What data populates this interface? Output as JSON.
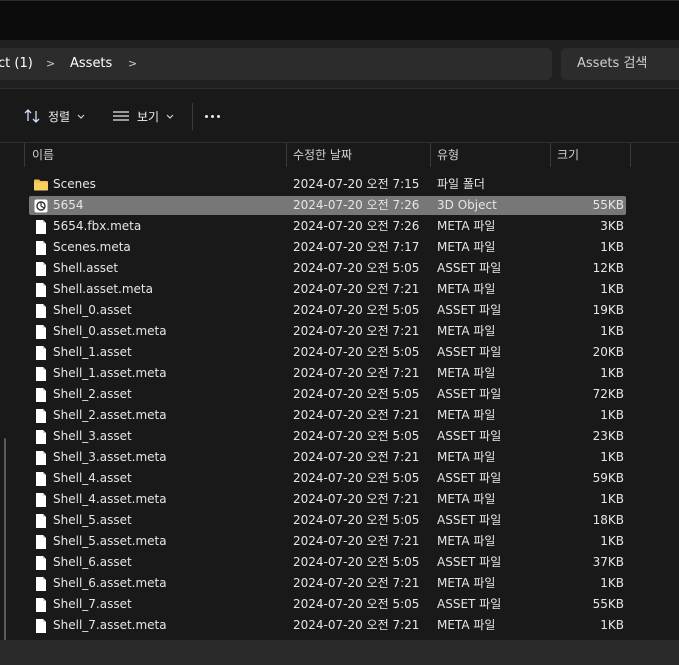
{
  "address": {
    "crumbs": [
      "ct (1)",
      "Assets"
    ],
    "search_placeholder": "Assets 검색"
  },
  "toolbar": {
    "sort_label": "정렬",
    "view_label": "보기"
  },
  "columns": {
    "name": "이름",
    "date": "수정한 날짜",
    "type": "유형",
    "size": "크기"
  },
  "files": [
    {
      "name": "Scenes",
      "date": "2024-07-20 오전 7:15",
      "type": "파일 폴더",
      "size": "",
      "icon": "folder-icon"
    },
    {
      "name": "5654",
      "date": "2024-07-20 오전 7:26",
      "type": "3D Object",
      "size": "55KB",
      "icon": "3d-object-icon",
      "selected": true
    },
    {
      "name": "5654.fbx.meta",
      "date": "2024-07-20 오전 7:26",
      "type": "META 파일",
      "size": "3KB",
      "icon": "file-icon"
    },
    {
      "name": "Scenes.meta",
      "date": "2024-07-20 오전 7:17",
      "type": "META 파일",
      "size": "1KB",
      "icon": "file-icon"
    },
    {
      "name": "Shell.asset",
      "date": "2024-07-20 오전 5:05",
      "type": "ASSET 파일",
      "size": "12KB",
      "icon": "file-icon"
    },
    {
      "name": "Shell.asset.meta",
      "date": "2024-07-20 오전 7:21",
      "type": "META 파일",
      "size": "1KB",
      "icon": "file-icon"
    },
    {
      "name": "Shell_0.asset",
      "date": "2024-07-20 오전 5:05",
      "type": "ASSET 파일",
      "size": "19KB",
      "icon": "file-icon"
    },
    {
      "name": "Shell_0.asset.meta",
      "date": "2024-07-20 오전 7:21",
      "type": "META 파일",
      "size": "1KB",
      "icon": "file-icon"
    },
    {
      "name": "Shell_1.asset",
      "date": "2024-07-20 오전 5:05",
      "type": "ASSET 파일",
      "size": "20KB",
      "icon": "file-icon"
    },
    {
      "name": "Shell_1.asset.meta",
      "date": "2024-07-20 오전 7:21",
      "type": "META 파일",
      "size": "1KB",
      "icon": "file-icon"
    },
    {
      "name": "Shell_2.asset",
      "date": "2024-07-20 오전 5:05",
      "type": "ASSET 파일",
      "size": "72KB",
      "icon": "file-icon"
    },
    {
      "name": "Shell_2.asset.meta",
      "date": "2024-07-20 오전 7:21",
      "type": "META 파일",
      "size": "1KB",
      "icon": "file-icon"
    },
    {
      "name": "Shell_3.asset",
      "date": "2024-07-20 오전 5:05",
      "type": "ASSET 파일",
      "size": "23KB",
      "icon": "file-icon"
    },
    {
      "name": "Shell_3.asset.meta",
      "date": "2024-07-20 오전 7:21",
      "type": "META 파일",
      "size": "1KB",
      "icon": "file-icon"
    },
    {
      "name": "Shell_4.asset",
      "date": "2024-07-20 오전 5:05",
      "type": "ASSET 파일",
      "size": "59KB",
      "icon": "file-icon"
    },
    {
      "name": "Shell_4.asset.meta",
      "date": "2024-07-20 오전 7:21",
      "type": "META 파일",
      "size": "1KB",
      "icon": "file-icon"
    },
    {
      "name": "Shell_5.asset",
      "date": "2024-07-20 오전 5:05",
      "type": "ASSET 파일",
      "size": "18KB",
      "icon": "file-icon"
    },
    {
      "name": "Shell_5.asset.meta",
      "date": "2024-07-20 오전 7:21",
      "type": "META 파일",
      "size": "1KB",
      "icon": "file-icon"
    },
    {
      "name": "Shell_6.asset",
      "date": "2024-07-20 오전 5:05",
      "type": "ASSET 파일",
      "size": "37KB",
      "icon": "file-icon"
    },
    {
      "name": "Shell_6.asset.meta",
      "date": "2024-07-20 오전 7:21",
      "type": "META 파일",
      "size": "1KB",
      "icon": "file-icon"
    },
    {
      "name": "Shell_7.asset",
      "date": "2024-07-20 오전 5:05",
      "type": "ASSET 파일",
      "size": "55KB",
      "icon": "file-icon"
    },
    {
      "name": "Shell_7.asset.meta",
      "date": "2024-07-20 오전 7:21",
      "type": "META 파일",
      "size": "1KB",
      "icon": "file-icon"
    }
  ],
  "colors": {
    "background": "#191919",
    "selection": "#777777",
    "folder": "#f2c04d"
  }
}
